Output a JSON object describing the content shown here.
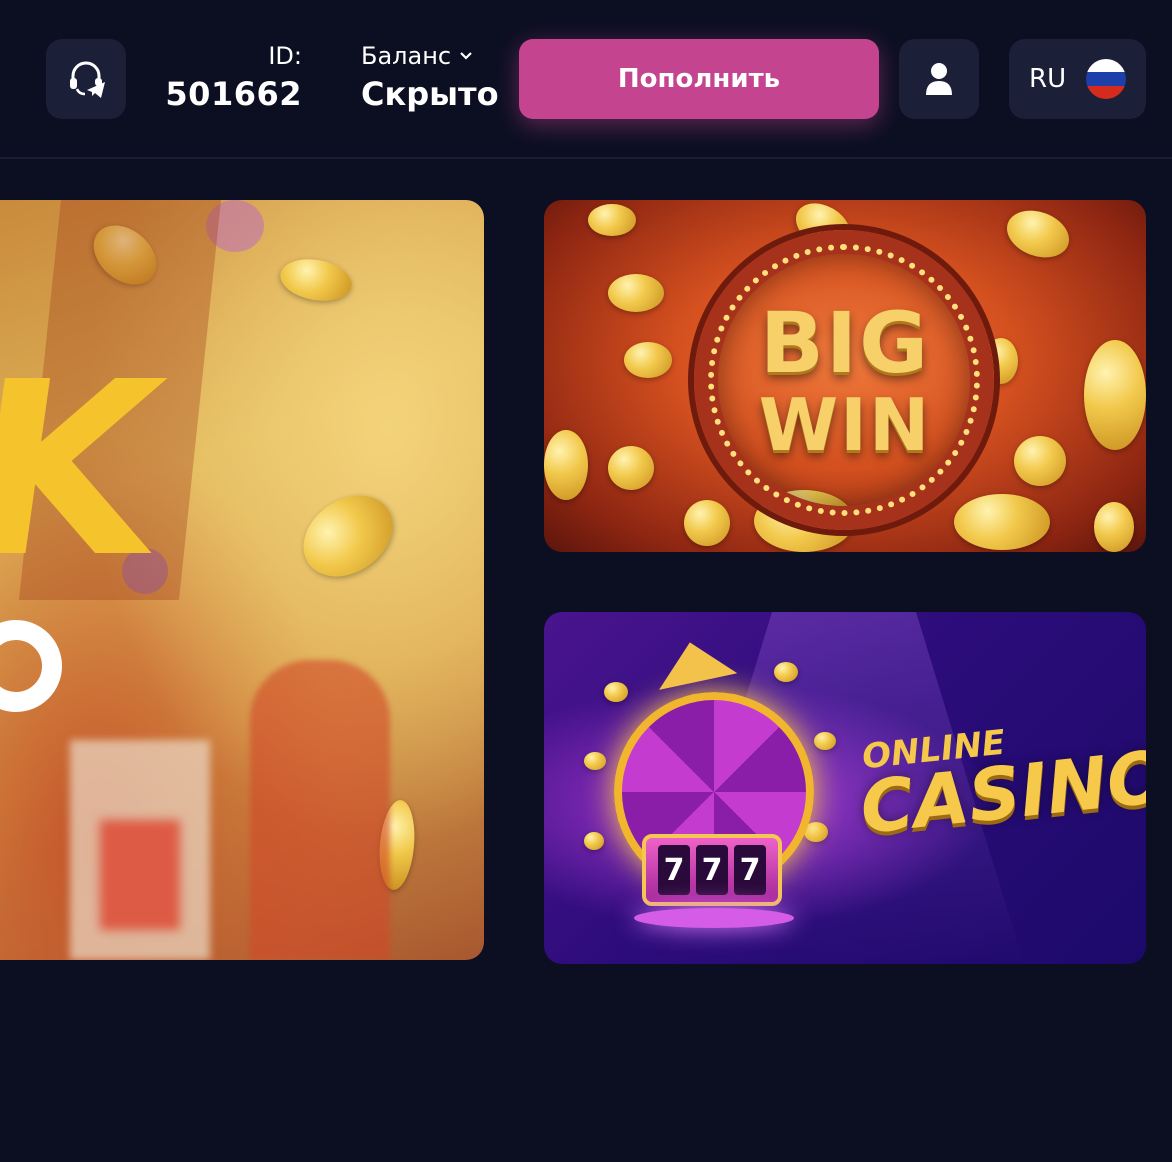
{
  "header": {
    "support_icon": "headset-telegram-icon",
    "id_label": "ID:",
    "id_value": "501662",
    "balance_label": "Баланс",
    "balance_value": "Скрыто",
    "deposit_label": "Пополнить",
    "profile_icon": "user-icon",
    "language_code": "RU",
    "flag_icon": "russia-flag-icon"
  },
  "banners": {
    "left": {
      "visible_text": "K"
    },
    "bigwin": {
      "line1": "BIG",
      "line2": "WIN"
    },
    "casino": {
      "line1": "ONLINE",
      "line2": "CASINO",
      "reels": [
        "7",
        "7",
        "7"
      ]
    }
  },
  "colors": {
    "background": "#0c0f22",
    "button_dark": "#1b1f38",
    "accent_pink": "#c4448f",
    "flag_white": "#ffffff",
    "flag_blue": "#1c3faa",
    "flag_red": "#d52b1e"
  }
}
